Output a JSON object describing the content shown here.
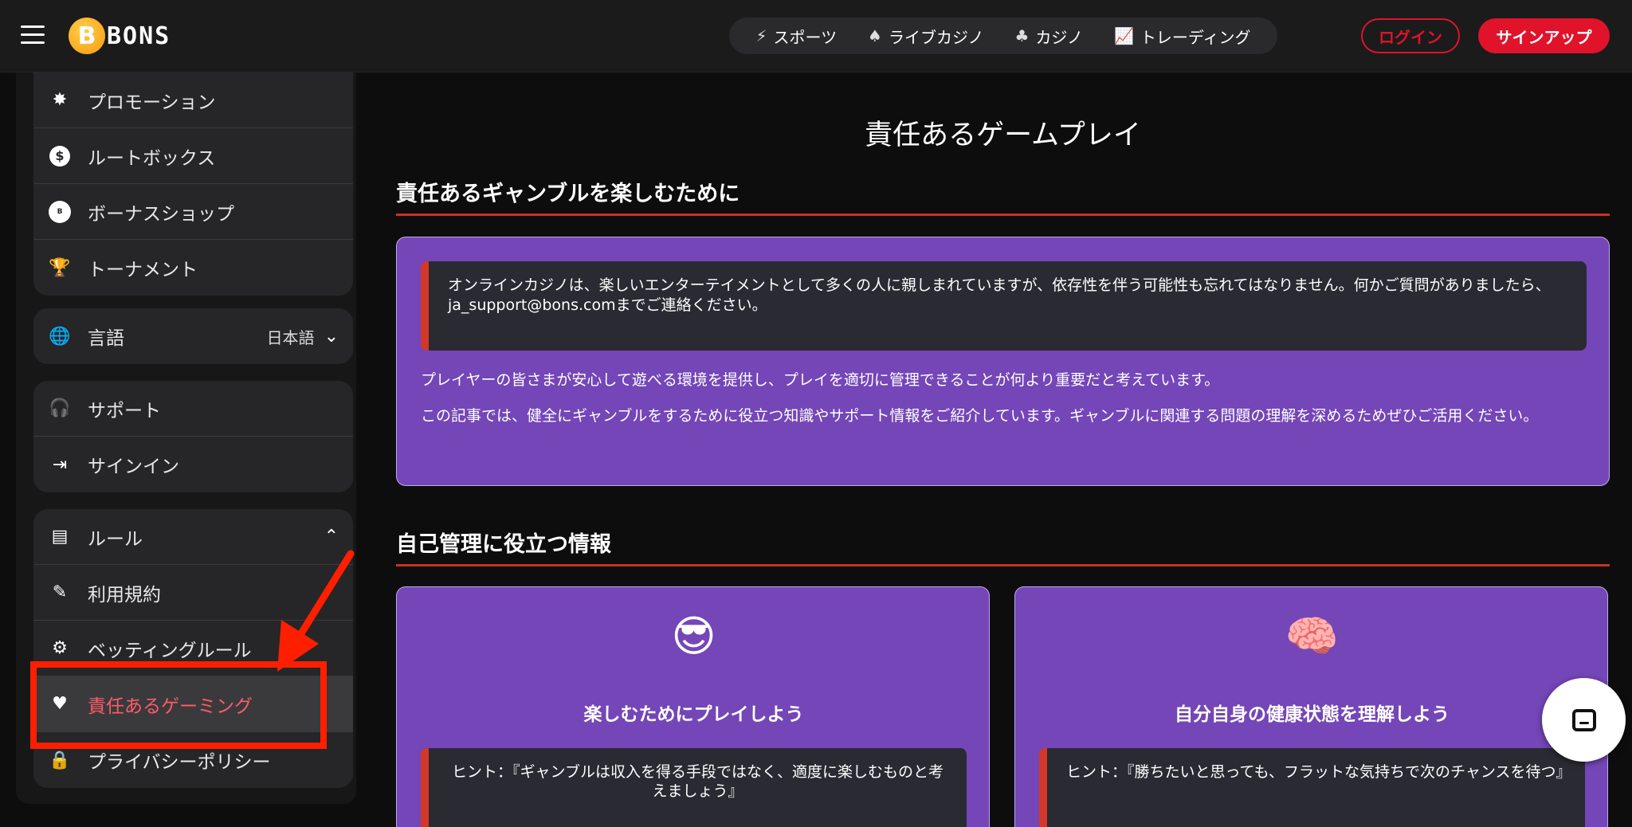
{
  "header": {
    "logo_text": "BONS",
    "logo_coin_letter": "B",
    "nav": [
      {
        "label": "スポーツ",
        "icon": "sports-icon"
      },
      {
        "label": "ライブカジノ",
        "icon": "live-casino-icon"
      },
      {
        "label": "カジノ",
        "icon": "casino-icon"
      },
      {
        "label": "トレーディング",
        "icon": "trading-icon"
      }
    ],
    "login": "ログイン",
    "signup": "サインアップ"
  },
  "sidebar": {
    "group1": [
      {
        "label": "プロモーション",
        "icon": "promotion-icon"
      },
      {
        "label": "ルートボックス",
        "icon": "lootbox-icon"
      },
      {
        "label": "ボーナスショップ",
        "icon": "bonus-shop-icon"
      },
      {
        "label": "トーナメント",
        "icon": "trophy-icon"
      }
    ],
    "language": {
      "label": "言語",
      "value": "日本語"
    },
    "group2": [
      {
        "label": "サポート",
        "icon": "support-icon"
      },
      {
        "label": "サインイン",
        "icon": "signin-icon"
      }
    ],
    "rules": {
      "label": "ルール",
      "items": [
        {
          "label": "利用規約",
          "icon": "terms-icon"
        },
        {
          "label": "ベッティングルール",
          "icon": "betting-rules-icon"
        },
        {
          "label": "責任あるゲーミング",
          "icon": "responsible-gaming-icon"
        },
        {
          "label": "プライバシーポリシー",
          "icon": "privacy-icon"
        }
      ]
    }
  },
  "main": {
    "title": "責任あるゲームプレイ",
    "section1_title": "責任あるギャンブルを楽しむために",
    "quote": "オンラインカジノは、楽しいエンターテイメントとして多くの人に親しまれていますが、依存性を伴う可能性も忘れてはなりません。何かご質問がありましたら、ja_support@bons.comまでご連絡ください。",
    "para1": "プレイヤーの皆さまが安心して遊べる環境を提供し、プレイを適切に管理できることが何より重要だと考えています。",
    "para2": "この記事では、健全にギャンブルをするために役立つ知識やサポート情報をご紹介しています。ギャンブルに関連する問題の理解を深めるためぜひご活用ください。",
    "section2_title": "自己管理に役立つ情報",
    "cards": [
      {
        "emoji": "😎",
        "title": "楽しむためにプレイしよう",
        "hint": "ヒント：『ギャンブルは収入を得る手段ではなく、適度に楽しむものと考えましょう』"
      },
      {
        "emoji": "🧠",
        "title": "自分自身の健康状態を理解しよう",
        "hint": "ヒント：『勝ちたいと思っても、フラットな気持ちで次のチャンスを待つ』"
      }
    ]
  },
  "colors": {
    "accent": "#e0132a",
    "card": "#7446b8",
    "annotation": "#ff1f00"
  }
}
